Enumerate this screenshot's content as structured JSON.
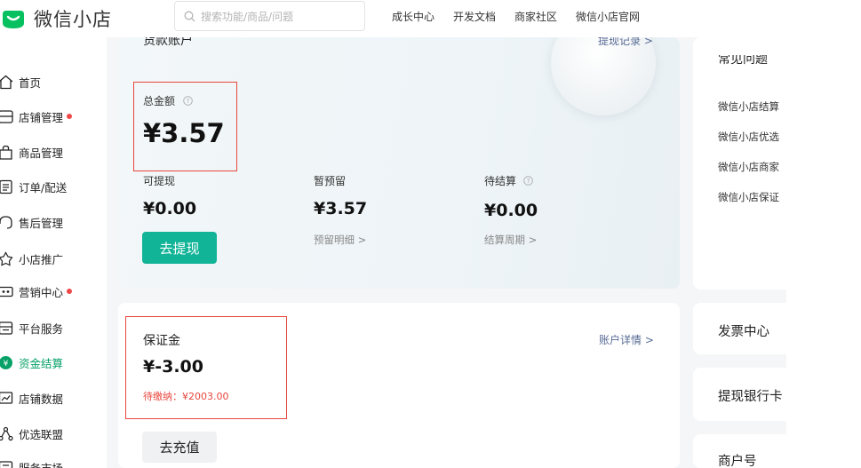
{
  "app": {
    "title": "微信小店"
  },
  "search": {
    "placeholder": "搜索功能/商品/问题"
  },
  "topnav": {
    "items": [
      "成长中心",
      "开发文档",
      "商家社区",
      "微信小店官网"
    ]
  },
  "sidebar": {
    "items": [
      {
        "label": "首页",
        "icon": "home-icon"
      },
      {
        "label": "店铺管理",
        "icon": "store-icon",
        "dot": true
      },
      {
        "label": "商品管理",
        "icon": "bag-icon"
      },
      {
        "label": "订单/配送",
        "icon": "order-icon"
      },
      {
        "label": "售后管理",
        "icon": "headset-icon"
      },
      {
        "label": "小店推广",
        "icon": "promote-icon"
      },
      {
        "label": "营销中心",
        "icon": "coupon-icon",
        "dot": true
      },
      {
        "label": "平台服务",
        "icon": "service-icon"
      },
      {
        "label": "资金结算",
        "icon": "yuan-icon",
        "active": true
      },
      {
        "label": "店铺数据",
        "icon": "chart-icon"
      },
      {
        "label": "优选联盟",
        "icon": "network-icon"
      },
      {
        "label": "服务市场",
        "icon": "market-icon"
      }
    ],
    "active_color": "#07a168",
    "dot_color": "#f04848"
  },
  "balance": {
    "title": "货款账户",
    "withdraw_record": "提现记录 >",
    "total_label": "总金额",
    "total_value": "¥3.57",
    "withdrawable_label": "可提现",
    "withdrawable_value": "¥0.00",
    "reserved_label": "暂预留",
    "reserved_value": "¥3.57",
    "reserved_link": "预留明细 >",
    "pending_label": "待结算",
    "pending_value": "¥0.00",
    "pending_link": "结算周期 >",
    "withdraw_button": "去提现"
  },
  "deposit": {
    "label": "保证金",
    "value": "¥-3.00",
    "due": "待缴纳：¥2003.00",
    "account_detail": "账户详情 >",
    "recharge_button": "去充值"
  },
  "faq": {
    "title": "常见问题",
    "items": [
      "微信小店结算",
      "微信小店优选",
      "微信小店商家",
      "微信小店保证"
    ]
  },
  "side_cards": [
    "发票中心",
    "提现银行卡",
    "商户号"
  ],
  "colors": {
    "primary": "#11b497",
    "highlight_border": "#e8463c",
    "link": "#576b95"
  }
}
